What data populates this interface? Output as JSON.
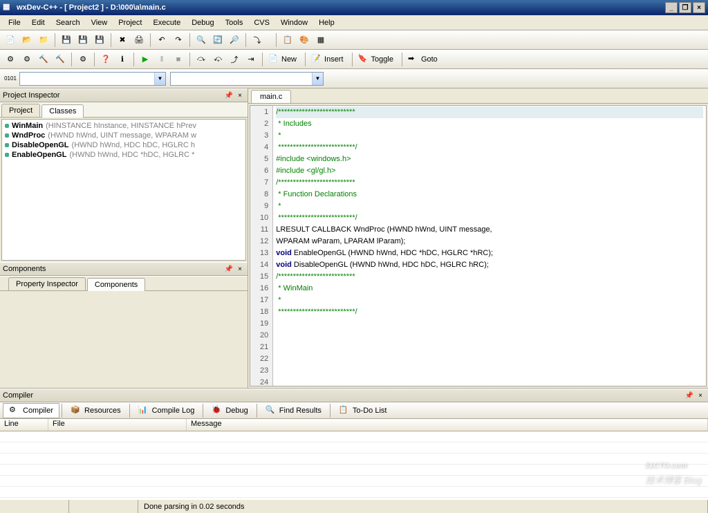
{
  "title": "wxDev-C++  - [ Project2 ] - D:\\000\\a\\main.c",
  "menus": [
    "File",
    "Edit",
    "Search",
    "View",
    "Project",
    "Execute",
    "Debug",
    "Tools",
    "CVS",
    "Window",
    "Help"
  ],
  "tb_labeled": {
    "new": "New",
    "insert": "Insert",
    "toggle": "Toggle",
    "goto": "Goto"
  },
  "inspector": {
    "title": "Project Inspector",
    "tabs": [
      "Project",
      "Classes"
    ],
    "active_tab": 1,
    "items": [
      {
        "fn": "WinMain",
        "sig": "(HINSTANCE hInstance, HINSTANCE hPrev"
      },
      {
        "fn": "WndProc",
        "sig": "(HWND hWnd, UINT message, WPARAM w"
      },
      {
        "fn": "DisableOpenGL",
        "sig": "(HWND hWnd, HDC hDC, HGLRC h"
      },
      {
        "fn": "EnableOpenGL",
        "sig": "(HWND hWnd, HDC *hDC, HGLRC *"
      }
    ]
  },
  "components": {
    "title": "Components",
    "tabs": [
      "Property Inspector",
      "Components"
    ],
    "active_tab": 1
  },
  "editor": {
    "tab": "main.c",
    "lines": [
      {
        "n": 1,
        "cls": "cm hl",
        "t": "/**************************"
      },
      {
        "n": 2,
        "cls": "cm",
        "t": " * Includes"
      },
      {
        "n": 3,
        "cls": "cm",
        "t": " *"
      },
      {
        "n": 4,
        "cls": "cm",
        "t": " **************************/"
      },
      {
        "n": 5,
        "cls": "",
        "t": ""
      },
      {
        "n": 6,
        "cls": "pp",
        "t": "#include <windows.h>"
      },
      {
        "n": 7,
        "cls": "pp",
        "t": "#include <gl/gl.h>"
      },
      {
        "n": 8,
        "cls": "",
        "t": ""
      },
      {
        "n": 9,
        "cls": "",
        "t": ""
      },
      {
        "n": 10,
        "cls": "cm",
        "t": "/**************************"
      },
      {
        "n": 11,
        "cls": "cm",
        "t": " * Function Declarations"
      },
      {
        "n": 12,
        "cls": "cm",
        "t": " *"
      },
      {
        "n": 13,
        "cls": "cm",
        "t": " **************************/"
      },
      {
        "n": 14,
        "cls": "",
        "t": ""
      },
      {
        "n": 15,
        "cls": "",
        "t": "LRESULT CALLBACK WndProc (HWND hWnd, UINT message,"
      },
      {
        "n": 16,
        "cls": "",
        "t": "WPARAM wParam, LPARAM lParam);"
      },
      {
        "n": 17,
        "cls": "",
        "html": "<span class='kw'>void</span> EnableOpenGL (HWND hWnd, HDC *hDC, HGLRC *hRC);"
      },
      {
        "n": 18,
        "cls": "",
        "html": "<span class='kw'>void</span> DisableOpenGL (HWND hWnd, HDC hDC, HGLRC hRC);"
      },
      {
        "n": 19,
        "cls": "",
        "t": ""
      },
      {
        "n": 20,
        "cls": "",
        "t": ""
      },
      {
        "n": 21,
        "cls": "cm",
        "t": "/**************************"
      },
      {
        "n": 22,
        "cls": "cm",
        "t": " * WinMain"
      },
      {
        "n": 23,
        "cls": "cm",
        "t": " *"
      },
      {
        "n": 24,
        "cls": "cm",
        "t": " **************************/"
      }
    ]
  },
  "compiler": {
    "title": "Compiler",
    "tabs": [
      "Compiler",
      "Resources",
      "Compile Log",
      "Debug",
      "Find Results",
      "To-Do List"
    ],
    "cols": [
      "Line",
      "File",
      "Message"
    ]
  },
  "status": "Done parsing in 0.02 seconds",
  "watermark": {
    "main": "51CTO.com",
    "sub": "技术博客  Blog"
  }
}
